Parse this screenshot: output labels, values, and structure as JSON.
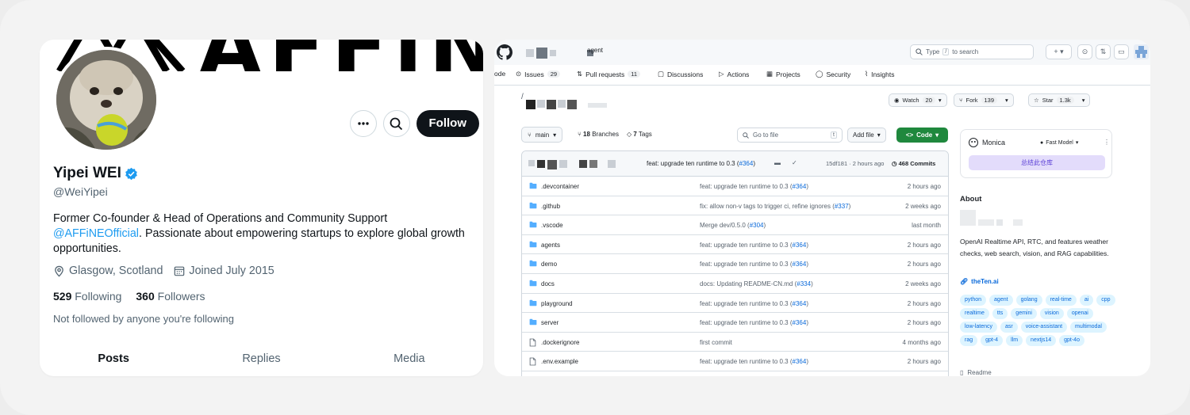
{
  "twitter": {
    "banner_text": "AFFiNE",
    "name": "Yipei WEI",
    "handle": "@WeiYipei",
    "bio_before": "Former Co-founder & Head of Operations and Community Support ",
    "bio_mention": "@AFFiNEOfficial",
    "bio_after": ". Passionate about empowering startups to explore global growth opportunities.",
    "location": "Glasgow, Scotland",
    "joined": "Joined July 2015",
    "following_count": "529",
    "following_label": "Following",
    "followers_count": "360",
    "followers_label": "Followers",
    "not_followed": "Not followed by anyone you're following",
    "follow_button": "Follow",
    "tabs": [
      {
        "label": "Posts",
        "active": true
      },
      {
        "label": "Replies",
        "active": false
      },
      {
        "label": "Media",
        "active": false
      }
    ],
    "colors": {
      "accent": "#1d9bf0",
      "text": "#0f1419",
      "muted": "#536471"
    }
  },
  "github": {
    "repo_suffix": "agent",
    "search_placeholder_before": "Type",
    "search_key": "/",
    "search_placeholder_after": "to search",
    "tabs": [
      {
        "label": "ode",
        "icon": "code-icon",
        "count": ""
      },
      {
        "label": "Issues",
        "icon": "issue-icon",
        "count": "29"
      },
      {
        "label": "Pull requests",
        "icon": "pr-icon",
        "count": "11"
      },
      {
        "label": "Discussions",
        "icon": "discussion-icon",
        "count": ""
      },
      {
        "label": "Actions",
        "icon": "play-icon",
        "count": ""
      },
      {
        "label": "Projects",
        "icon": "table-icon",
        "count": ""
      },
      {
        "label": "Security",
        "icon": "shield-icon",
        "count": ""
      },
      {
        "label": "Insights",
        "icon": "graph-icon",
        "count": ""
      }
    ],
    "watch_label": "Watch",
    "watch_count": "20",
    "fork_label": "Fork",
    "fork_count": "139",
    "star_label": "Star",
    "star_count": "1.3k",
    "branch": "main",
    "branches_count": "18",
    "branches_label": "Branches",
    "tags_count": "7",
    "tags_label": "Tags",
    "goto_placeholder": "Go to file",
    "goto_key": "t",
    "add_file": "Add file",
    "code_button": "Code",
    "last_commit": {
      "message": "feat: upgrade ten runtime to 0.3 (",
      "pr": "#364",
      "hash": "15df181",
      "time": "2 hours ago",
      "commits": "468 Commits"
    },
    "files": [
      {
        "name": ".devcontainer",
        "type": "dir",
        "msg": "feat: upgrade ten runtime to 0.3 (",
        "pr": "#364",
        "time": "2 hours ago"
      },
      {
        "name": ".github",
        "type": "dir",
        "msg": "fix: allow non-v tags to trigger ci, refine ignores (",
        "pr": "#337",
        "time": "2 weeks ago"
      },
      {
        "name": ".vscode",
        "type": "dir",
        "msg": "Merge dev/0.5.0 (",
        "pr": "#304",
        "time": "last month"
      },
      {
        "name": "agents",
        "type": "dir",
        "msg": "feat: upgrade ten runtime to 0.3 (",
        "pr": "#364",
        "time": "2 hours ago"
      },
      {
        "name": "demo",
        "type": "dir",
        "msg": "feat: upgrade ten runtime to 0.3 (",
        "pr": "#364",
        "time": "2 hours ago"
      },
      {
        "name": "docs",
        "type": "dir",
        "msg": "docs: Updating README-CN.md (",
        "pr": "#334",
        "time": "2 weeks ago"
      },
      {
        "name": "playground",
        "type": "dir",
        "msg": "feat: upgrade ten runtime to 0.3 (",
        "pr": "#364",
        "time": "2 hours ago"
      },
      {
        "name": "server",
        "type": "dir",
        "msg": "feat: upgrade ten runtime to 0.3 (",
        "pr": "#364",
        "time": "2 hours ago"
      },
      {
        "name": ".dockerignore",
        "type": "file",
        "msg": "first commit",
        "pr": "",
        "time": "4 months ago"
      },
      {
        "name": ".env.example",
        "type": "file",
        "msg": "feat: upgrade ten runtime to 0.3 (",
        "pr": "#364",
        "time": "2 hours ago"
      }
    ],
    "monica": {
      "name": "Monica",
      "model": "Fast Model",
      "button": "总结此仓库"
    },
    "about_title": "About",
    "about_desc": "OpenAI Realtime API, RTC, and features weather checks, web search, vision, and RAG capabilities.",
    "about_link": "theTen.ai",
    "topics": [
      "python",
      "agent",
      "golang",
      "real-time",
      "ai",
      "cpp",
      "realtime",
      "tts",
      "gemini",
      "vision",
      "openai",
      "low-latency",
      "asr",
      "voice-assistant",
      "multimodal",
      "rag",
      "gpt-4",
      "llm",
      "nextjs14",
      "gpt-4o"
    ],
    "readme_label": "Readme",
    "colors": {
      "link": "#0969da",
      "green": "#1f883d",
      "topic_bg": "#ddf4ff",
      "monica_btn": "#e3dcfb"
    }
  }
}
